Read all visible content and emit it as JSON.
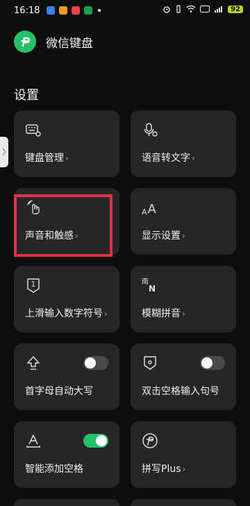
{
  "status_bar": {
    "time": "16:18",
    "battery": "92",
    "app_icon_colors": [
      "#3b82f6",
      "#f59e0b",
      "#ef4444",
      "#16a34a"
    ],
    "icons": [
      "alarm-icon",
      "vibrate-icon",
      "wifi-icon",
      "hd-icon",
      "signal-icon",
      "battery-icon"
    ]
  },
  "header": {
    "title": "微信键盘",
    "logo_color": "#27c06a"
  },
  "section": {
    "title": "设置"
  },
  "cards": [
    {
      "label": "键盘管理",
      "icon": "keyboard-settings-icon",
      "chevron": "›"
    },
    {
      "label": "语音转文字",
      "icon": "mic-settings-icon",
      "chevron": "›"
    },
    {
      "label": "声音和触感",
      "icon": "touch-vibration-icon",
      "chevron": "›"
    },
    {
      "label": "显示设置",
      "icon": "font-size-icon",
      "chevron": "›"
    },
    {
      "label": "上滑输入数字符号",
      "icon": "number-badge-icon",
      "chevron": "›"
    },
    {
      "label": "模糊拼音",
      "icon": "fuzzy-pinyin-icon",
      "chevron": "›"
    },
    {
      "label": "首字母自动大写",
      "icon": "arrow-up-outline-icon",
      "toggle_on": false
    },
    {
      "label": "双击空格输入句号",
      "icon": "shield-dot-icon",
      "toggle_on": false
    },
    {
      "label": "智能添加空格",
      "icon": "letter-a-icon",
      "toggle_on": true
    },
    {
      "label": "拼写Plus",
      "icon": "pinyin-plus-icon",
      "chevron": "›"
    }
  ],
  "icon_glyphs": {
    "font_size_small": "A",
    "font_size_large": "A",
    "number_badge": "1",
    "fuzzy_top": "南",
    "fuzzy_bottom": "N"
  },
  "highlight_color": "#e23248"
}
